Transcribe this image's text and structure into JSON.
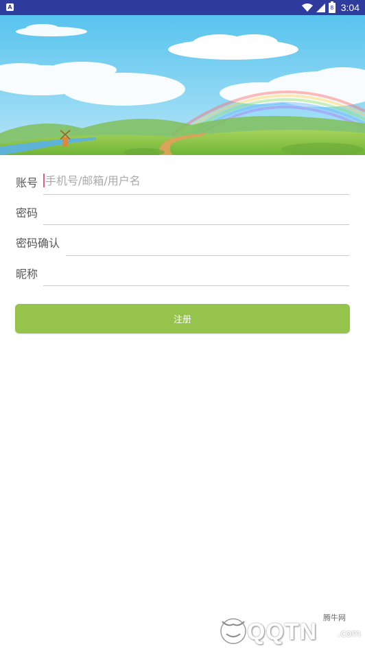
{
  "status_bar": {
    "app_icon_letter": "A",
    "battery_text": "8",
    "time": "3:04"
  },
  "form": {
    "account": {
      "label": "账号",
      "placeholder": "手机号/邮箱/用户名",
      "value": ""
    },
    "password": {
      "label": "密码",
      "value": ""
    },
    "password_confirm": {
      "label": "密码确认",
      "value": ""
    },
    "nickname": {
      "label": "昵称",
      "value": ""
    }
  },
  "register_button": {
    "label": "注册",
    "color": "#96c34b"
  },
  "watermark": {
    "text": "QQTN",
    "suffix": ".com",
    "small": "腾牛网"
  },
  "colors": {
    "status_bar": "#2f3c9e",
    "sky": "#7fd0ef",
    "grass": "#8cc43c",
    "caret": "#e55b7c"
  }
}
